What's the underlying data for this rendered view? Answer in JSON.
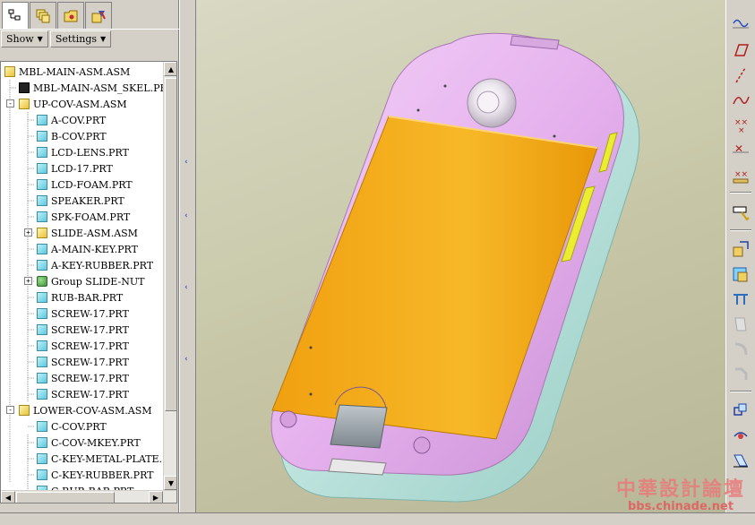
{
  "navigator": {
    "toolbar": {
      "show_label": "Show",
      "settings_label": "Settings"
    },
    "tree": [
      {
        "label": "MBL-MAIN-ASM.ASM",
        "type": "asm",
        "level": 0,
        "expander": ""
      },
      {
        "label": "MBL-MAIN-ASM_SKEL.PRT",
        "type": "skel",
        "level": 1,
        "expander": ""
      },
      {
        "label": "UP-COV-ASM.ASM",
        "type": "asm",
        "level": 1,
        "expander": "-"
      },
      {
        "label": "A-COV.PRT",
        "type": "part",
        "level": 2,
        "expander": ""
      },
      {
        "label": "B-COV.PRT",
        "type": "part",
        "level": 2,
        "expander": ""
      },
      {
        "label": "LCD-LENS.PRT",
        "type": "part",
        "level": 2,
        "expander": ""
      },
      {
        "label": "LCD-17.PRT",
        "type": "part",
        "level": 2,
        "expander": ""
      },
      {
        "label": "LCD-FOAM.PRT",
        "type": "part",
        "level": 2,
        "expander": ""
      },
      {
        "label": "SPEAKER.PRT",
        "type": "part",
        "level": 2,
        "expander": ""
      },
      {
        "label": "SPK-FOAM.PRT",
        "type": "part",
        "level": 2,
        "expander": ""
      },
      {
        "label": "SLIDE-ASM.ASM",
        "type": "asm",
        "level": 2,
        "expander": "+"
      },
      {
        "label": "A-MAIN-KEY.PRT",
        "type": "part",
        "level": 2,
        "expander": ""
      },
      {
        "label": "A-KEY-RUBBER.PRT",
        "type": "part",
        "level": 2,
        "expander": ""
      },
      {
        "label": "Group SLIDE-NUT",
        "type": "group",
        "level": 2,
        "expander": "+"
      },
      {
        "label": "RUB-BAR.PRT",
        "type": "part",
        "level": 2,
        "expander": ""
      },
      {
        "label": "SCREW-17.PRT",
        "type": "part",
        "level": 2,
        "expander": ""
      },
      {
        "label": "SCREW-17.PRT",
        "type": "part",
        "level": 2,
        "expander": ""
      },
      {
        "label": "SCREW-17.PRT",
        "type": "part",
        "level": 2,
        "expander": ""
      },
      {
        "label": "SCREW-17.PRT",
        "type": "part",
        "level": 2,
        "expander": ""
      },
      {
        "label": "SCREW-17.PRT",
        "type": "part",
        "level": 2,
        "expander": ""
      },
      {
        "label": "SCREW-17.PRT",
        "type": "part",
        "level": 2,
        "expander": ""
      },
      {
        "label": "LOWER-COV-ASM.ASM",
        "type": "asm",
        "level": 1,
        "expander": "-"
      },
      {
        "label": "C-COV.PRT",
        "type": "part",
        "level": 2,
        "expander": ""
      },
      {
        "label": "C-COV-MKEY.PRT",
        "type": "part",
        "level": 2,
        "expander": ""
      },
      {
        "label": "C-KEY-METAL-PLATE.",
        "type": "part",
        "level": 2,
        "expander": ""
      },
      {
        "label": "C-KEY-RUBBER.PRT",
        "type": "part",
        "level": 2,
        "expander": ""
      },
      {
        "label": "C-RUB-BAR.PRT",
        "type": "part",
        "level": 2,
        "expander": ""
      }
    ]
  },
  "nav_tab_icons": [
    "model-tree-icon",
    "layers-icon",
    "folder-icon",
    "favorites-icon"
  ],
  "right_toolbar_icons": [
    "sketch-datum-icon",
    "datum-plane-icon",
    "datum-axis-icon",
    "datum-curve-icon",
    "datum-point-icon",
    "datum-point-offset-icon",
    "datum-csys-icon",
    "analysis-icon",
    "copy-feature-icon",
    "paste-feature-icon",
    "trim-icon",
    "extend-icon",
    "round-icon",
    "chamfer-icon",
    "mirror-icon",
    "pattern-icon",
    "draft-icon"
  ],
  "watermark": {
    "title": "中華設計論壇",
    "url": "bbs.chinade.net"
  },
  "colors": {
    "battery_cover": "#f5b320",
    "housing": "#e8b8f0",
    "lower_housing": "#bfe8e4",
    "side_key": "#ecec30",
    "viewport_bg": "#c6c6a6"
  }
}
